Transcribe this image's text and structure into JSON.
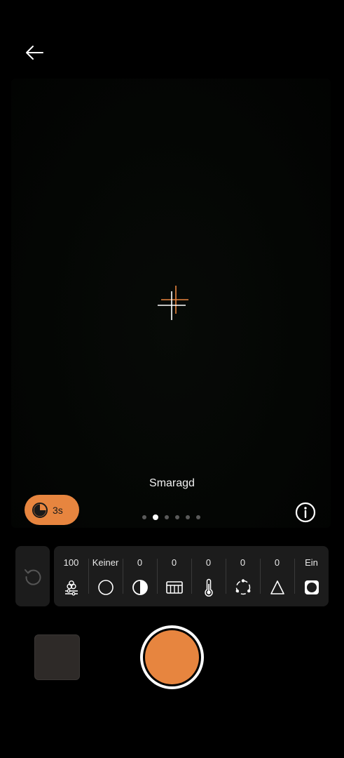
{
  "header": {
    "back_icon": "arrow-left-icon"
  },
  "viewfinder": {
    "focus_icon": "crosshair-icon",
    "filter_name": "Smaragd"
  },
  "timer": {
    "label": "3s",
    "icon": "timer-icon",
    "color": "#e7853f"
  },
  "filter_pager": {
    "count": 6,
    "active_index": 1
  },
  "info": {
    "icon": "info-icon"
  },
  "adjustments": [
    {
      "id": "intensity",
      "value": "100",
      "icon": "filter-intensity-icon"
    },
    {
      "id": "vignette",
      "value": "Keiner",
      "icon": "circle-icon"
    },
    {
      "id": "contrast",
      "value": "0",
      "icon": "contrast-icon"
    },
    {
      "id": "grain",
      "value": "0",
      "icon": "grid-icon"
    },
    {
      "id": "temperature",
      "value": "0",
      "icon": "thermometer-icon"
    },
    {
      "id": "saturation",
      "value": "0",
      "icon": "saturation-icon"
    },
    {
      "id": "sharpness",
      "value": "0",
      "icon": "triangle-icon"
    },
    {
      "id": "frame",
      "value": "Ein",
      "icon": "frame-icon"
    }
  ],
  "reset": {
    "icon": "reset-icon"
  },
  "shutter": {
    "color": "#e7853f"
  }
}
